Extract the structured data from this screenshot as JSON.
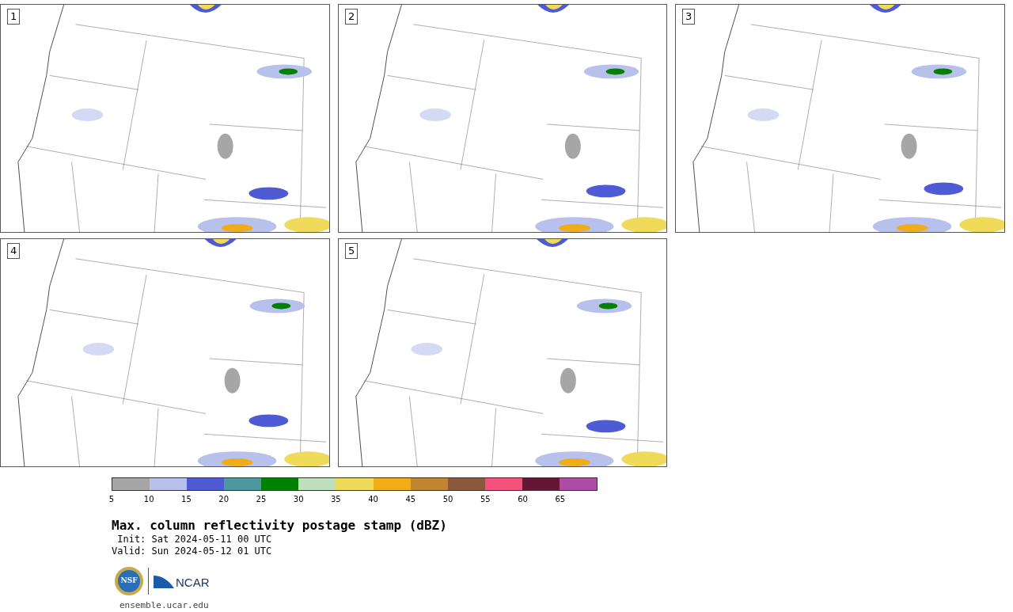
{
  "panels": [
    {
      "label": "1"
    },
    {
      "label": "2"
    },
    {
      "label": "3"
    },
    {
      "label": "4"
    },
    {
      "label": "5"
    }
  ],
  "colorbar": {
    "segments": [
      {
        "color": "#a6a6a6"
      },
      {
        "color": "#b7c1ec"
      },
      {
        "color": "#4f5bd5"
      },
      {
        "color": "#4f979e"
      },
      {
        "color": "#008200"
      },
      {
        "color": "#bfdfbe"
      },
      {
        "color": "#f0da5a"
      },
      {
        "color": "#f0ad18"
      },
      {
        "color": "#bf8530"
      },
      {
        "color": "#8b5a3c"
      },
      {
        "color": "#f6517c"
      },
      {
        "color": "#641733"
      },
      {
        "color": "#ad4ca6"
      }
    ],
    "ticks": [
      "5",
      "10",
      "15",
      "20",
      "25",
      "30",
      "35",
      "40",
      "45",
      "50",
      "55",
      "60",
      "65"
    ]
  },
  "title": "Max. column reflectivity postage stamp (dBZ)",
  "init": " Init: Sat 2024-05-11 00 UTC",
  "valid": "Valid: Sun 2024-05-12 01 UTC",
  "logos": {
    "nsf": "NSF",
    "ncar": "NCAR"
  },
  "url": "ensemble.ucar.edu"
}
